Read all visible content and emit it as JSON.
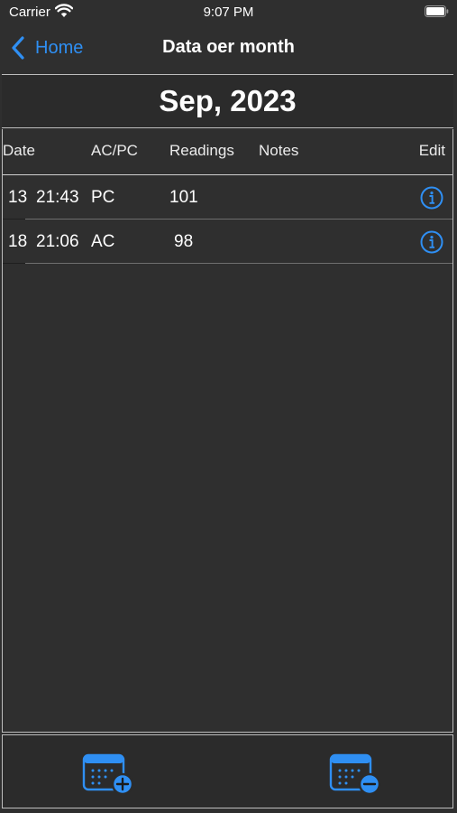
{
  "status_bar": {
    "carrier": "Carrier",
    "time": "9:07 PM"
  },
  "nav": {
    "back_label": "Home",
    "title": "Data oer month"
  },
  "month_title": "Sep, 2023",
  "columns": {
    "date": "Date",
    "type": "AC/PC",
    "readings": "Readings",
    "notes": "Notes",
    "edit": "Edit"
  },
  "rows": [
    {
      "day": "13",
      "time": "21:43",
      "type": "PC",
      "reading": "101",
      "notes": ""
    },
    {
      "day": "18",
      "time": "21:06",
      "type": "AC",
      "reading": "98",
      "notes": ""
    }
  ],
  "toolbar": {
    "add_icon": "calendar-add-icon",
    "remove_icon": "calendar-remove-icon"
  },
  "colors": {
    "accent": "#2f8ff3",
    "background": "#2f2f2f",
    "text": "#ffffff",
    "divider": "#bdbdbd"
  }
}
